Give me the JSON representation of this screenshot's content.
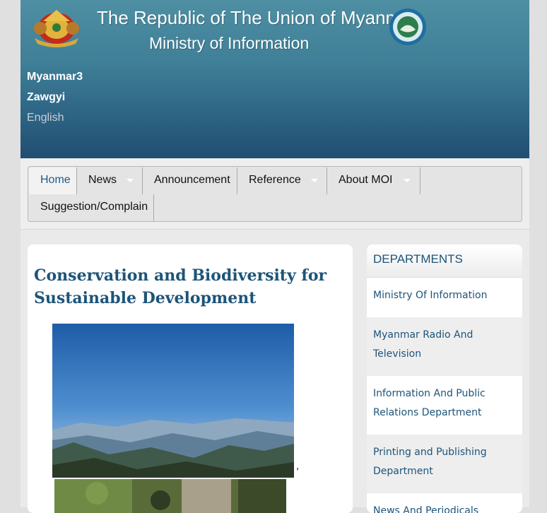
{
  "header": {
    "title_line1": "The Republic of The Union of Myanmar",
    "title_line2": "Ministry of Information",
    "emblem_icon": "state-emblem-icon",
    "ministry_logo_icon": "ministry-logo-icon"
  },
  "languages": [
    {
      "label": "Myanmar3"
    },
    {
      "label": "Zawgyi"
    },
    {
      "label": "English"
    }
  ],
  "nav": {
    "items": [
      {
        "label": "Home",
        "active": true,
        "has_dropdown": false
      },
      {
        "label": "News",
        "active": false,
        "has_dropdown": true
      },
      {
        "label": "Announcement",
        "active": false,
        "has_dropdown": false
      },
      {
        "label": "Reference",
        "active": false,
        "has_dropdown": true
      },
      {
        "label": "About MOI",
        "active": false,
        "has_dropdown": true
      },
      {
        "label": "Suggestion/Complain",
        "active": false,
        "has_dropdown": false
      }
    ]
  },
  "article": {
    "title": "Conservation and Biodiversity for Sustainable Development",
    "trailing_text": ","
  },
  "departments": {
    "title": "DEPARTMENTS",
    "items": [
      {
        "label": "Ministry Of Information"
      },
      {
        "label": "Myanmar Radio And Television"
      },
      {
        "label": "Information And Public Relations Department"
      },
      {
        "label": "Printing and Publishing Department"
      },
      {
        "label": "News And Periodicals Enterprise"
      }
    ]
  },
  "colors": {
    "header_top": "#4e8fa3",
    "header_bottom": "#214e70",
    "accent_text": "#1d5479"
  }
}
